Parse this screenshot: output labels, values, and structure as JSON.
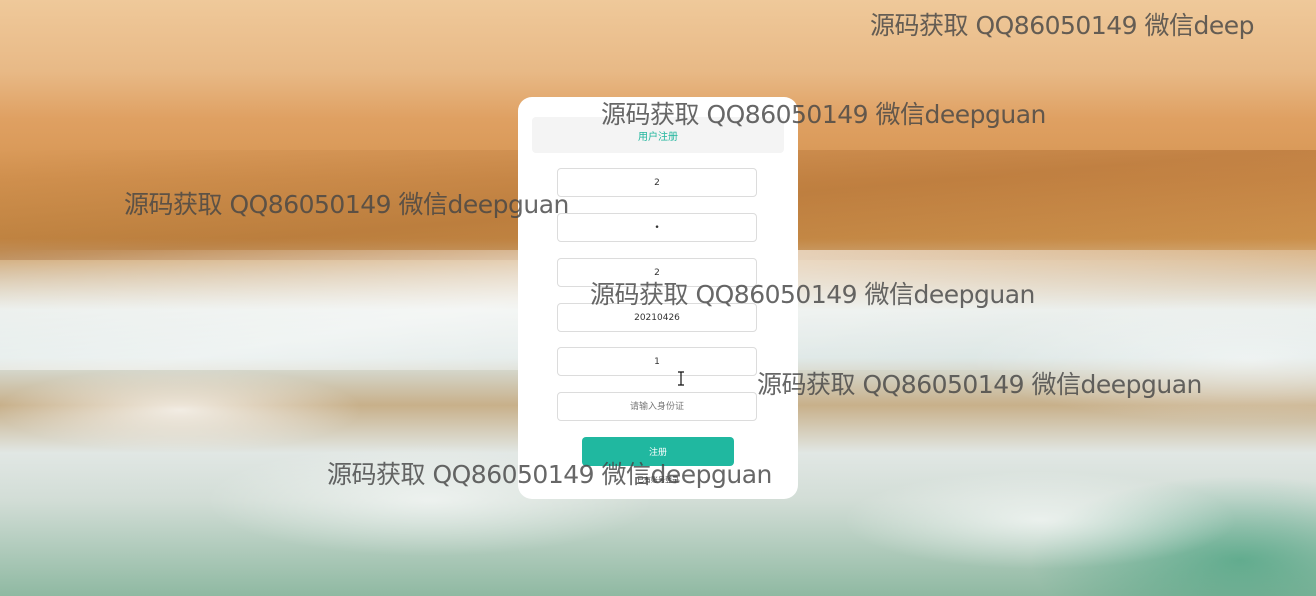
{
  "form": {
    "title": "用户注册",
    "fields": [
      {
        "name": "username",
        "value": "2",
        "placeholder": ""
      },
      {
        "name": "password",
        "value": "•",
        "placeholder": ""
      },
      {
        "name": "field3",
        "value": "2",
        "placeholder": ""
      },
      {
        "name": "field4",
        "value": "20210426",
        "placeholder": ""
      },
      {
        "name": "field5",
        "value": "1",
        "placeholder": ""
      },
      {
        "name": "id_card",
        "value": "",
        "placeholder": "请输入身份证"
      }
    ],
    "submit_label": "注册",
    "login_link": "已有账号登录"
  },
  "watermark": {
    "text": "源码获取 QQ86050149 微信deepguan",
    "partial_text": "源码获取 QQ86050149 微信deep"
  },
  "colors": {
    "accent": "#20b8a0",
    "title": "#1fb59c"
  },
  "icons": {
    "cursor": "text-cursor-icon"
  }
}
